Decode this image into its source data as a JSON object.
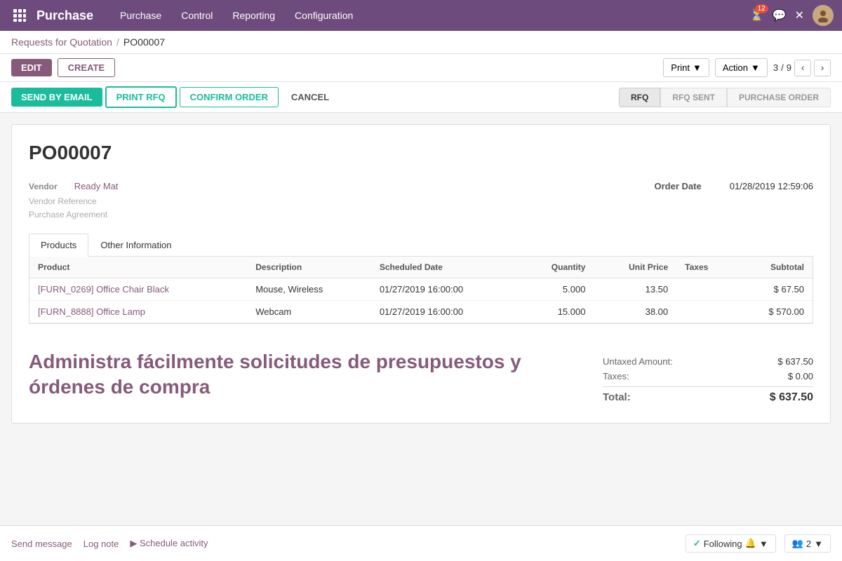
{
  "app": {
    "title": "Purchase",
    "nav": {
      "items": [
        "Purchase",
        "Control",
        "Reporting",
        "Configuration"
      ]
    },
    "notifications_count": "12"
  },
  "breadcrumb": {
    "parent": "Requests for Quotation",
    "separator": "/",
    "current": "PO00007"
  },
  "action_bar": {
    "edit_label": "EDIT",
    "create_label": "CREATE",
    "print_label": "Print",
    "action_label": "Action",
    "pagination": {
      "current": "3",
      "total": "9"
    }
  },
  "doc_actions": {
    "send_by_email": "SEND BY EMAIL",
    "print_rfq": "PRINT RFQ",
    "confirm_order": "CONFIRM ORDER",
    "cancel": "CANCEL"
  },
  "status_pills": [
    "RFQ",
    "RFQ SENT",
    "PURCHASE ORDER"
  ],
  "active_status": "RFQ",
  "document": {
    "po_number": "PO00007",
    "vendor_label": "Vendor",
    "vendor_value": "Ready Mat",
    "vendor_reference_label": "Vendor Reference",
    "purchase_agreement_label": "Purchase Agreement",
    "order_date_label": "Order Date",
    "order_date_value": "01/28/2019 12:59:06"
  },
  "tabs": [
    "Products",
    "Other Information"
  ],
  "active_tab": "Products",
  "table": {
    "headers": [
      "Product",
      "Description",
      "Scheduled Date",
      "Quantity",
      "Unit Price",
      "Taxes",
      "Subtotal"
    ],
    "rows": [
      {
        "product": "[FURN_0269] Office Chair Black",
        "description": "Mouse, Wireless",
        "scheduled_date": "01/27/2019 16:00:00",
        "quantity": "5.000",
        "unit_price": "13.50",
        "taxes": "",
        "subtotal": "$ 67.50"
      },
      {
        "product": "[FURN_8888] Office Lamp",
        "description": "Webcam",
        "scheduled_date": "01/27/2019 16:00:00",
        "quantity": "15.000",
        "unit_price": "38.00",
        "taxes": "",
        "subtotal": "$ 570.00"
      }
    ]
  },
  "promo": {
    "text": "Administra fácilmente solicitudes de presupuestos y órdenes de compra"
  },
  "totals": {
    "untaxed_label": "Untaxed Amount:",
    "untaxed_value": "$ 637.50",
    "taxes_label": "Taxes:",
    "taxes_value": "$ 0.00",
    "total_label": "Total:",
    "total_value": "$ 637.50"
  },
  "bottom": {
    "send_message": "Send message",
    "log_note": "Log note",
    "schedule_activity": "Schedule activity",
    "following_label": "Following",
    "followers_label": "2"
  }
}
